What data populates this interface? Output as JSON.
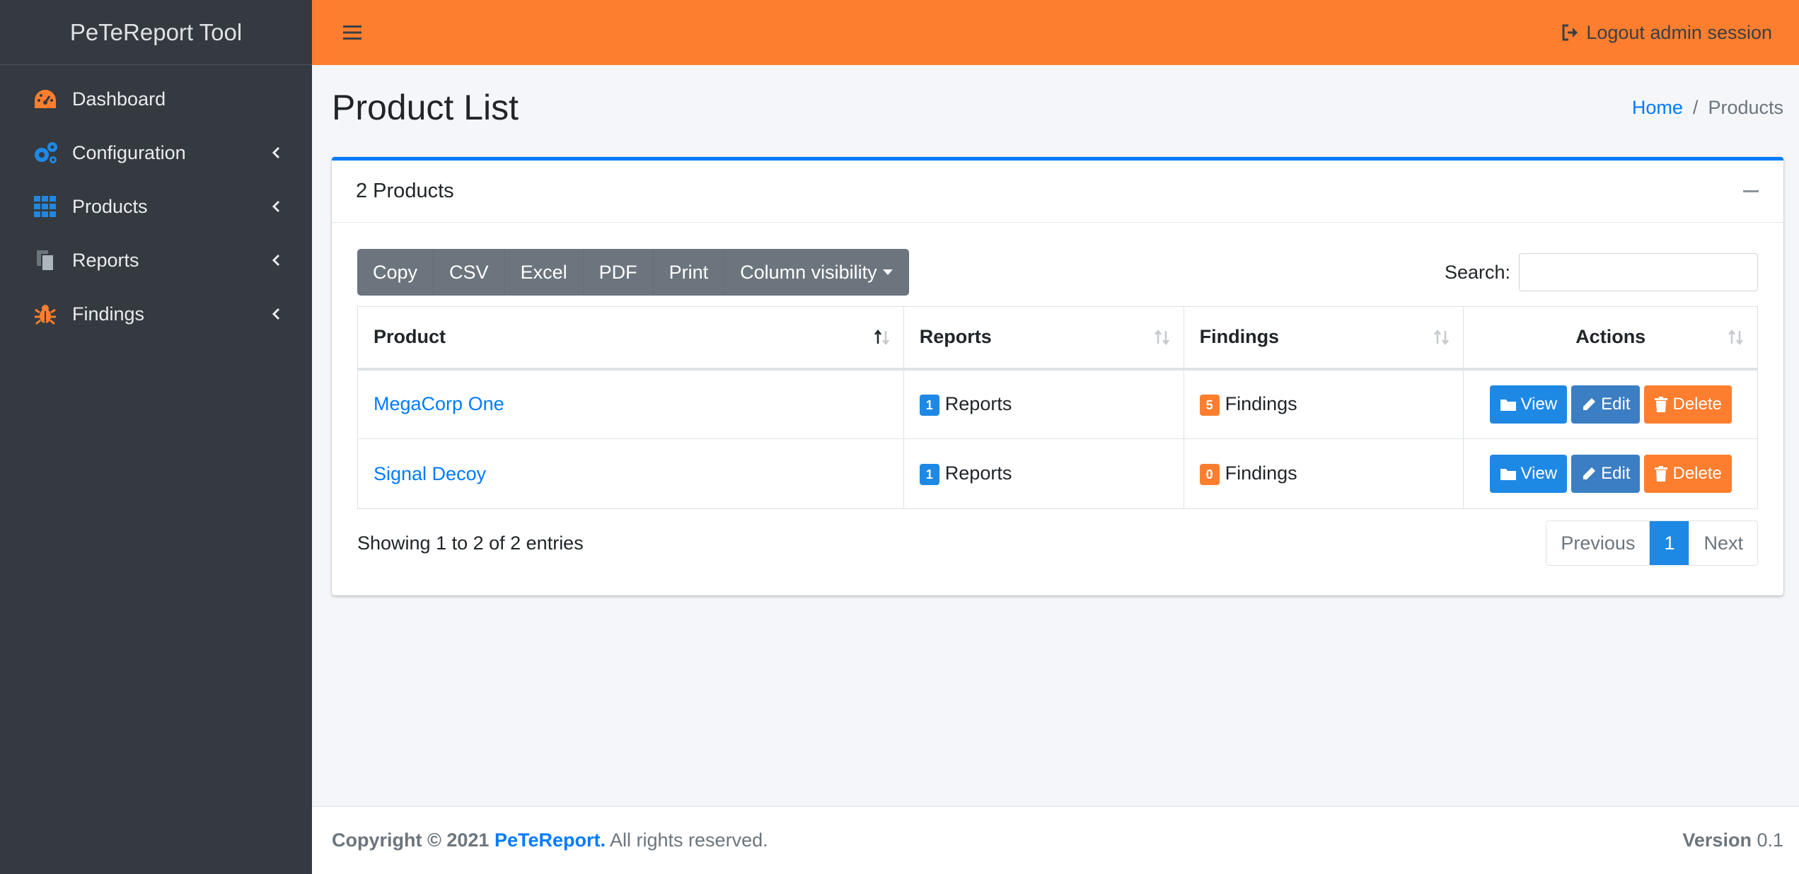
{
  "sidebar": {
    "brand": "PeTeReport Tool",
    "items": [
      {
        "label": "Dashboard"
      },
      {
        "label": "Configuration"
      },
      {
        "label": "Products"
      },
      {
        "label": "Reports"
      },
      {
        "label": "Findings"
      }
    ]
  },
  "topbar": {
    "logout_label": "Logout admin session"
  },
  "page": {
    "title": "Product List",
    "breadcrumb": {
      "home": "Home",
      "current": "Products",
      "separator": "/"
    }
  },
  "card": {
    "title": "2 Products",
    "toolbar": [
      "Copy",
      "CSV",
      "Excel",
      "PDF",
      "Print",
      "Column visibility"
    ],
    "search_label": "Search:",
    "search_value": "",
    "columns": [
      "Product",
      "Reports",
      "Findings",
      "Actions"
    ],
    "rows": [
      {
        "product": "MegaCorp One",
        "reports_count": "1",
        "reports_label": "Reports",
        "findings_count": "5",
        "findings_label": "Findings"
      },
      {
        "product": "Signal Decoy",
        "reports_count": "1",
        "reports_label": "Reports",
        "findings_count": "0",
        "findings_label": "Findings"
      }
    ],
    "actions": {
      "view": "View",
      "edit": "Edit",
      "delete": "Delete"
    },
    "info": "Showing 1 to 2 of 2 entries",
    "pagination": {
      "previous": "Previous",
      "current": "1",
      "next": "Next"
    }
  },
  "footer": {
    "copyright": "Copyright © 2021",
    "brand": "PeTeReport.",
    "rights": "All rights reserved.",
    "version_label": "Version",
    "version_value": "0.1"
  },
  "colors": {
    "accent": "#fd7e2e",
    "primary": "#1e88e5",
    "sidebar": "#343a40"
  }
}
